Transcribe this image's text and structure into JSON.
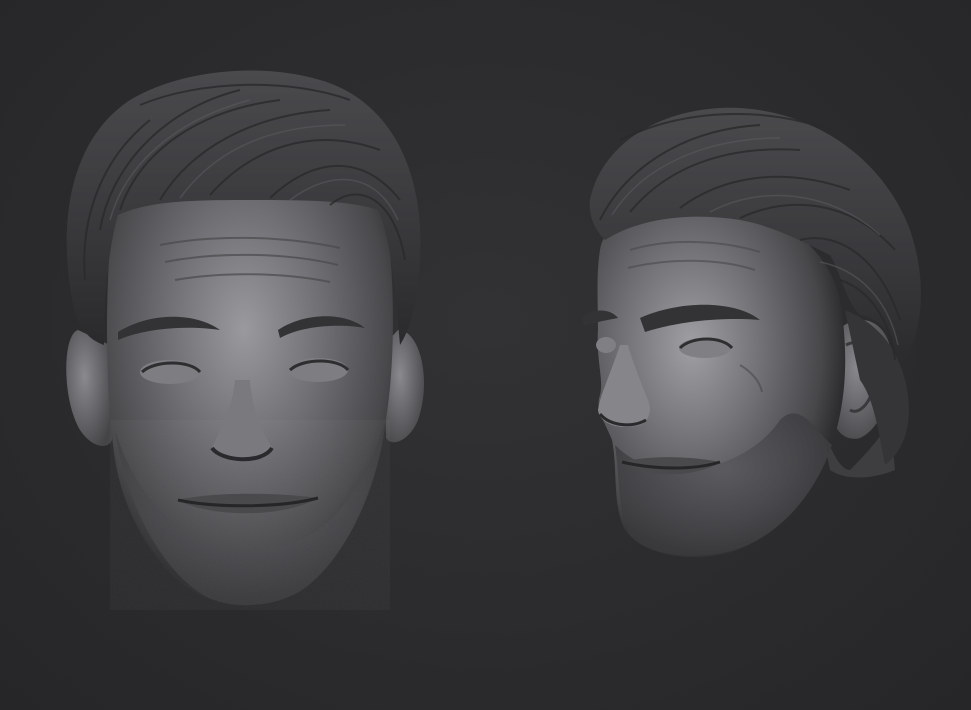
{
  "scene": {
    "background_color": "#2c2c2e",
    "model_base_color": "#6a6a6e",
    "model_highlight_color": "#a8a8ac",
    "model_shadow_color": "#1f1f21",
    "hair_color": "#3a3a3d",
    "views": [
      {
        "id": "front",
        "orientation": "front"
      },
      {
        "id": "three-quarter",
        "orientation": "three-quarter-left"
      }
    ]
  }
}
